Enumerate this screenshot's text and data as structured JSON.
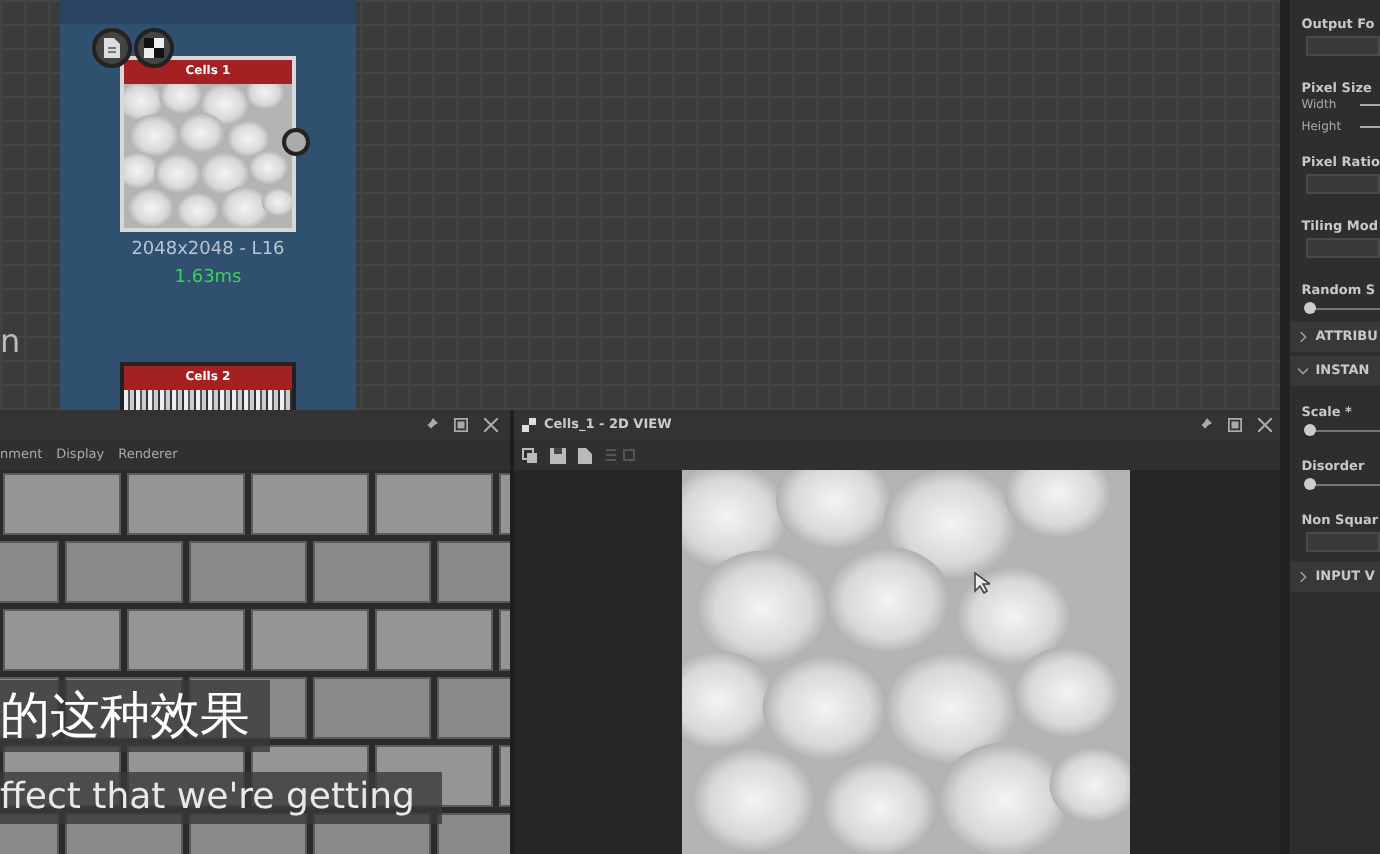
{
  "graph": {
    "canvas_text": "n",
    "nodes": [
      {
        "title": "Cells 1",
        "resolution": "2048x2048 - L16",
        "time": "1.63ms"
      },
      {
        "title": "Cells 2"
      }
    ]
  },
  "view_3d": {
    "menu": [
      "nment",
      "Display",
      "Renderer"
    ]
  },
  "view_2d": {
    "title": "Cells_1 - 2D VIEW"
  },
  "properties": {
    "items": [
      {
        "kind": "label",
        "text": "Output Fo"
      },
      {
        "kind": "dropdown"
      },
      {
        "kind": "label",
        "text": "Pixel Size"
      },
      {
        "kind": "sub_slider",
        "text": "Width"
      },
      {
        "kind": "sub_slider",
        "text": "Height"
      },
      {
        "kind": "label",
        "text": "Pixel Ratio"
      },
      {
        "kind": "dropdown"
      },
      {
        "kind": "label",
        "text": "Tiling Mod"
      },
      {
        "kind": "dropdown"
      },
      {
        "kind": "label",
        "text": "Random S"
      },
      {
        "kind": "slider",
        "level": 0
      },
      {
        "kind": "section",
        "text": "ATTRIBU",
        "expanded": false
      },
      {
        "kind": "section",
        "text": "INSTAN",
        "expanded": true
      },
      {
        "kind": "label",
        "text": "Scale *"
      },
      {
        "kind": "slider",
        "level": 0
      },
      {
        "kind": "label",
        "text": "Disorder"
      },
      {
        "kind": "slider",
        "level": 0
      },
      {
        "kind": "label",
        "text": "Non Squar"
      },
      {
        "kind": "dropdown"
      },
      {
        "kind": "section",
        "text": "INPUT V",
        "expanded": false
      }
    ]
  },
  "subtitles": [
    "的这种效果",
    "ffect that we're getting"
  ]
}
